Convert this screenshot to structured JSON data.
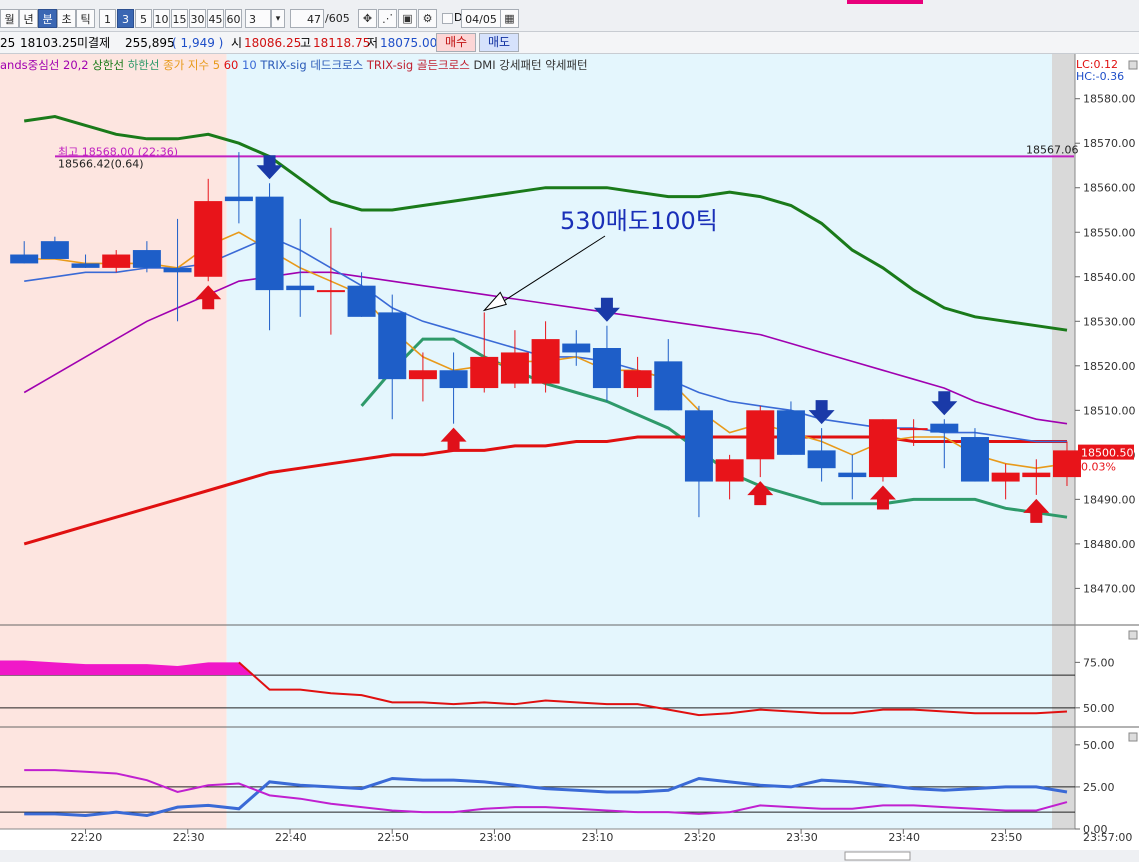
{
  "toolbar": {
    "period_buttons": [
      "월",
      "년",
      "분",
      "초",
      "틱"
    ],
    "selected_period": "분",
    "interval_buttons": [
      "1",
      "3",
      "5",
      "10",
      "15",
      "30",
      "45",
      "60"
    ],
    "selected_interval": "3",
    "interval_value": "3",
    "count_value": "47",
    "count_total": "/605",
    "date_value": "04/05",
    "icons": [
      "tool-icon",
      "line-tool-icon",
      "save-icon",
      "settings-icon"
    ]
  },
  "quote": {
    "price_prefix": "25",
    "current": "18103.25",
    "open_interest_label": "미결제",
    "open_interest": "255,895",
    "oi_change": "( 1,949 )",
    "open_label": "시",
    "open": "18086.25",
    "high_label": "고",
    "high": "18118.75",
    "low_label": "저",
    "low": "18075.00",
    "buy_label": "매수",
    "sell_label": "매도"
  },
  "legend": [
    {
      "text": "ands중심선 20,2",
      "color": "#a000b0"
    },
    {
      "text": "상한선",
      "color": "#1a7a1a"
    },
    {
      "text": "하한선",
      "color": "#2e9a6a"
    },
    {
      "text": "종가 지수 5",
      "color": "#e89a1a"
    },
    {
      "text": "60",
      "color": "#e01010"
    },
    {
      "text": "10",
      "color": "#3a6ad6"
    },
    {
      "text": "TRIX-sig 데드크로스",
      "color": "#2a5ab8"
    },
    {
      "text": "TRIX-sig 골든크로스",
      "color": "#c02030"
    },
    {
      "text": "DMI 강세패턴",
      "color": "#333333"
    },
    {
      "text": "약세패턴",
      "color": "#333333"
    }
  ],
  "lc_label": "LC:0.12",
  "hc_label": "HC:-0.36",
  "high_annotation": "최고 18568.00 (22:36)",
  "high_sub_annotation": "18566.42(0.64)",
  "hline_value_label": "18567.06",
  "current_price_label": "18500.50",
  "current_pct_label": "0.03%",
  "note_text": "530매도100틱",
  "time_axis": [
    "22:20",
    "22:30",
    "22:40",
    "22:50",
    "23:00",
    "23:10",
    "23:20",
    "23:30",
    "23:40",
    "23:50"
  ],
  "last_time_label": "23:57:00",
  "sub1_ticks": [
    "75.00",
    "50.00"
  ],
  "sub2_ticks": [
    "50.00",
    "25.00",
    "0.00"
  ],
  "colors": {
    "up": "#e8141a",
    "down": "#1e5ec8",
    "bg_session1": "#fde5e0",
    "bg_session2": "#e4f6fd"
  },
  "chart_data": {
    "type": "candlestick",
    "y_range": [
      18462,
      18586
    ],
    "y_ticks": [
      18470,
      18480,
      18490,
      18500,
      18510,
      18520,
      18530,
      18540,
      18550,
      18560,
      18570,
      18580
    ],
    "interval_minutes": 3,
    "times": [
      "22:14",
      "22:17",
      "22:20",
      "22:23",
      "22:26",
      "22:29",
      "22:32",
      "22:35",
      "22:38",
      "22:41",
      "22:44",
      "22:47",
      "22:50",
      "22:53",
      "22:56",
      "22:59",
      "23:02",
      "23:05",
      "23:08",
      "23:11",
      "23:14",
      "23:17",
      "23:20",
      "23:23",
      "23:26",
      "23:29",
      "23:32",
      "23:35",
      "23:38",
      "23:41",
      "23:44",
      "23:47",
      "23:50",
      "23:53",
      "23:56"
    ],
    "candles": [
      {
        "o": 18545,
        "h": 18548,
        "l": 18543,
        "c": 18543
      },
      {
        "o": 18548,
        "h": 18549,
        "l": 18544,
        "c": 18544
      },
      {
        "o": 18543,
        "h": 18545,
        "l": 18542,
        "c": 18542
      },
      {
        "o": 18542,
        "h": 18546,
        "l": 18541,
        "c": 18545
      },
      {
        "o": 18546,
        "h": 18548,
        "l": 18541,
        "c": 18542
      },
      {
        "o": 18542,
        "h": 18553,
        "l": 18530,
        "c": 18541
      },
      {
        "o": 18540,
        "h": 18562,
        "l": 18539,
        "c": 18557
      },
      {
        "o": 18558,
        "h": 18568,
        "l": 18552,
        "c": 18557
      },
      {
        "o": 18558,
        "h": 18561,
        "l": 18528,
        "c": 18537
      },
      {
        "o": 18538,
        "h": 18553,
        "l": 18531,
        "c": 18537
      },
      {
        "o": 18537,
        "h": 18551,
        "l": 18527,
        "c": 18537
      },
      {
        "o": 18538,
        "h": 18541,
        "l": 18531,
        "c": 18531
      },
      {
        "o": 18532,
        "h": 18536,
        "l": 18508,
        "c": 18517
      },
      {
        "o": 18517,
        "h": 18523,
        "l": 18512,
        "c": 18519
      },
      {
        "o": 18519,
        "h": 18523,
        "l": 18507,
        "c": 18515
      },
      {
        "o": 18515,
        "h": 18532,
        "l": 18514,
        "c": 18522
      },
      {
        "o": 18516,
        "h": 18528,
        "l": 18515,
        "c": 18523
      },
      {
        "o": 18516,
        "h": 18530,
        "l": 18514,
        "c": 18526
      },
      {
        "o": 18525,
        "h": 18528,
        "l": 18520,
        "c": 18523
      },
      {
        "o": 18524,
        "h": 18529,
        "l": 18512,
        "c": 18515
      },
      {
        "o": 18515,
        "h": 18522,
        "l": 18513,
        "c": 18519
      },
      {
        "o": 18521,
        "h": 18526,
        "l": 18510,
        "c": 18510
      },
      {
        "o": 18510,
        "h": 18511,
        "l": 18486,
        "c": 18494
      },
      {
        "o": 18494,
        "h": 18500,
        "l": 18490,
        "c": 18499
      },
      {
        "o": 18499,
        "h": 18511,
        "l": 18495,
        "c": 18510
      },
      {
        "o": 18510,
        "h": 18512,
        "l": 18500,
        "c": 18500
      },
      {
        "o": 18501,
        "h": 18506,
        "l": 18494,
        "c": 18497
      },
      {
        "o": 18496,
        "h": 18500,
        "l": 18490,
        "c": 18495
      },
      {
        "o": 18495,
        "h": 18508,
        "l": 18494,
        "c": 18508
      },
      {
        "o": 18506,
        "h": 18508,
        "l": 18502,
        "c": 18506
      },
      {
        "o": 18507,
        "h": 18508,
        "l": 18497,
        "c": 18505
      },
      {
        "o": 18504,
        "h": 18506,
        "l": 18494,
        "c": 18494
      },
      {
        "o": 18494,
        "h": 18498,
        "l": 18490,
        "c": 18496
      },
      {
        "o": 18495,
        "h": 18499,
        "l": 18491,
        "c": 18496
      },
      {
        "o": 18495,
        "h": 18503,
        "l": 18493,
        "c": 18501
      }
    ],
    "series": [
      {
        "color": "#1a7a1a",
        "values": [
          18575,
          18576,
          18574,
          18572,
          18571,
          18571,
          18572,
          18570,
          18567,
          18562,
          18557,
          18555,
          18555,
          18556,
          18557,
          18558,
          18559,
          18560,
          18560,
          18560,
          18559,
          18558,
          18558,
          18559,
          18558,
          18556,
          18552,
          18546,
          18542,
          18537,
          18533,
          18531,
          18530,
          18529,
          18528
        ]
      },
      {
        "color": "#2e9a6a",
        "values": [
          null,
          null,
          null,
          null,
          null,
          null,
          null,
          null,
          null,
          null,
          null,
          18511,
          18519,
          18526,
          18526,
          18522,
          18519,
          18516,
          18514,
          18512,
          18509,
          18506,
          18501,
          18496,
          18493,
          18491,
          18489,
          18489,
          18489,
          18490,
          18490,
          18490,
          18488,
          18487,
          18486
        ]
      },
      {
        "color": "#a000b0",
        "values": [
          18514,
          18518,
          18522,
          18526,
          18530,
          18533,
          18536,
          18539,
          18540,
          18541,
          18541,
          18540,
          18539,
          18538,
          18537,
          18536,
          18535,
          18534,
          18533,
          18532,
          18531,
          18530,
          18529,
          18528,
          18527,
          18525,
          18523,
          18521,
          18519,
          18517,
          18515,
          18512,
          18510,
          18508,
          18507
        ]
      },
      {
        "color": "#e01010",
        "values": [
          18480,
          18482,
          18484,
          18486,
          18488,
          18490,
          18492,
          18494,
          18496,
          18497,
          18498,
          18499,
          18500,
          18500,
          18501,
          18501,
          18502,
          18502,
          18503,
          18503,
          18504,
          18504,
          18504,
          18504,
          18504,
          18504,
          18504,
          18504,
          18504,
          18503,
          18503,
          18503,
          18503,
          18503,
          18503
        ]
      },
      {
        "color": "#3a6ad6",
        "values": [
          18539,
          18540,
          18541,
          18541,
          18542,
          18542,
          18543,
          18546,
          18549,
          18546,
          18542,
          18538,
          18533,
          18530,
          18528,
          18526,
          18524,
          18522,
          18522,
          18521,
          18519,
          18517,
          18514,
          18512,
          18511,
          18510,
          18508,
          18507,
          18506,
          18506,
          18505,
          18505,
          18504,
          18503,
          18503
        ]
      },
      {
        "color": "#e89a1a",
        "values": [
          18544,
          18544,
          18543,
          18543,
          18543,
          18542,
          18547,
          18550,
          18546,
          18542,
          18539,
          18536,
          18528,
          18522,
          18519,
          18520,
          18521,
          18521,
          18522,
          18519,
          18519,
          18517,
          18510,
          18505,
          18507,
          18505,
          18503,
          18500,
          18503,
          18504,
          18504,
          18500,
          18498,
          18497,
          18498
        ]
      }
    ],
    "sell_signal_indices": [
      8,
      19,
      26,
      30
    ],
    "buy_signal_indices": [
      6,
      14,
      24,
      28,
      33
    ],
    "high_line": 18567.06,
    "current_price": 18500.5,
    "sub1_range": [
      40,
      95
    ],
    "sub1_lines": [
      68,
      50
    ],
    "sub1_series": {
      "color": "#e01010",
      "values": [
        76,
        75,
        74,
        74,
        74,
        73,
        75,
        75,
        60,
        60,
        58,
        57,
        53,
        53,
        52,
        53,
        52,
        54,
        53,
        52,
        52,
        49,
        46,
        47,
        49,
        48,
        47,
        47,
        49,
        49,
        48,
        47,
        47,
        47,
        48
      ]
    },
    "sub2_range": [
      0,
      60
    ],
    "sub2_lines": [
      25,
      10
    ],
    "sub2_series": [
      {
        "color": "#3a6ad6",
        "values": [
          9,
          9,
          8,
          10,
          8,
          13,
          14,
          12,
          28,
          26,
          25,
          24,
          30,
          29,
          29,
          28,
          26,
          24,
          23,
          22,
          22,
          23,
          30,
          28,
          26,
          25,
          29,
          28,
          26,
          24,
          23,
          24,
          25,
          25,
          22
        ]
      },
      {
        "color": "#c020d0",
        "values": [
          35,
          35,
          34,
          33,
          29,
          22,
          26,
          27,
          20,
          18,
          15,
          13,
          11,
          10,
          10,
          12,
          13,
          13,
          12,
          11,
          10,
          10,
          9,
          10,
          14,
          13,
          12,
          12,
          14,
          14,
          13,
          12,
          11,
          11,
          16
        ]
      }
    ]
  }
}
